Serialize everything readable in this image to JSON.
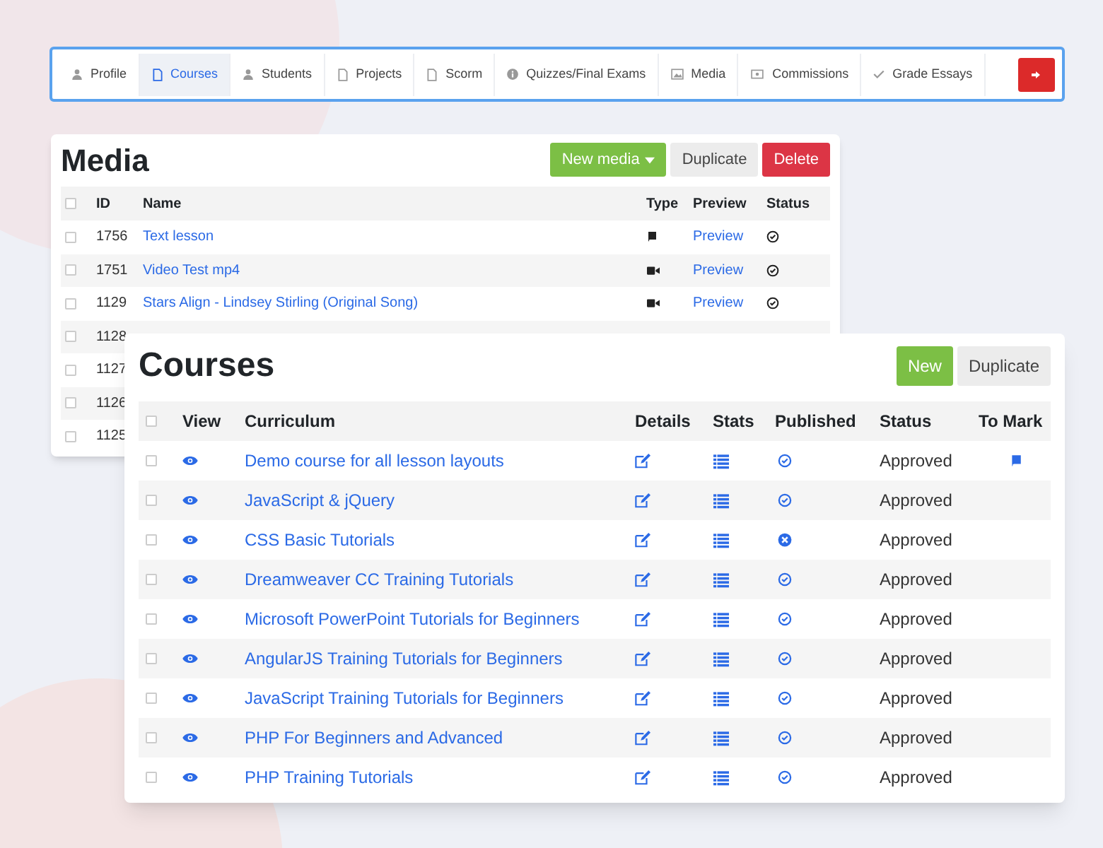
{
  "nav": {
    "tabs": [
      {
        "label": "Profile",
        "kind": "user",
        "selected": false
      },
      {
        "label": "Courses",
        "kind": "file",
        "selected": true
      },
      {
        "label": "Students",
        "kind": "user",
        "selected": false
      },
      {
        "label": "Projects",
        "kind": "file",
        "selected": false
      },
      {
        "label": "Scorm",
        "kind": "file",
        "selected": false
      },
      {
        "label": "Quizzes/Final Exams",
        "kind": "info",
        "selected": false
      },
      {
        "label": "Media",
        "kind": "image",
        "selected": false
      },
      {
        "label": "Commissions",
        "kind": "money",
        "selected": false
      },
      {
        "label": "Grade Essays",
        "kind": "check",
        "selected": false
      }
    ]
  },
  "media": {
    "title": "Media",
    "buttons": [
      {
        "label": "New media",
        "kind": "dropdown"
      },
      {
        "label": "Duplicate",
        "kind": "plain"
      },
      {
        "label": "Delete",
        "kind": "danger"
      }
    ],
    "all_checked": false,
    "columns": [
      "ID",
      "Name",
      "Type",
      "Preview",
      "Status"
    ],
    "rows": [
      {
        "checked": false,
        "id": "1756",
        "name": "Text lesson",
        "kind": "text",
        "preview": "Preview"
      },
      {
        "checked": false,
        "id": "1751",
        "name": "Video Test mp4",
        "kind": "video",
        "preview": "Preview"
      },
      {
        "checked": false,
        "id": "1129",
        "name": "Stars Align - Lindsey Stirling (Original Song)",
        "kind": "video",
        "preview": "Preview"
      },
      {
        "checked": false,
        "id": "1128"
      },
      {
        "checked": false,
        "id": "1127"
      },
      {
        "checked": false,
        "id": "1126"
      },
      {
        "checked": false,
        "id": "1125"
      }
    ]
  },
  "courses": {
    "title": "Courses",
    "buttons": [
      {
        "label": "New",
        "kind": "primary"
      },
      {
        "label": "Duplicate",
        "kind": "plain"
      }
    ],
    "all_checked": false,
    "columns": [
      "View",
      "Curriculum",
      "Details",
      "Stats",
      "Published",
      "Status",
      "To Mark"
    ],
    "rows": [
      {
        "checked": false,
        "name": "Demo course for all lesson layouts",
        "published": true,
        "status": "Approved",
        "to_mark": true
      },
      {
        "checked": false,
        "name": "JavaScript & jQuery",
        "published": true,
        "status": "Approved",
        "to_mark": false
      },
      {
        "checked": false,
        "name": "CSS Basic Tutorials",
        "published": false,
        "status": "Approved",
        "to_mark": false
      },
      {
        "checked": false,
        "name": "Dreamweaver CC Training Tutorials",
        "published": true,
        "status": "Approved",
        "to_mark": false
      },
      {
        "checked": false,
        "name": "Microsoft PowerPoint Tutorials for Beginners",
        "published": true,
        "status": "Approved",
        "to_mark": false
      },
      {
        "checked": false,
        "name": "AngularJS Training Tutorials for Beginners",
        "published": true,
        "status": "Approved",
        "to_mark": false
      },
      {
        "checked": false,
        "name": "JavaScript Training Tutorials for Beginners",
        "published": true,
        "status": "Approved",
        "to_mark": false
      },
      {
        "checked": false,
        "name": "PHP For Beginners and Advanced",
        "published": true,
        "status": "Approved",
        "to_mark": false
      },
      {
        "checked": false,
        "name": "PHP Training Tutorials",
        "published": true,
        "status": "Approved",
        "to_mark": false
      }
    ]
  }
}
